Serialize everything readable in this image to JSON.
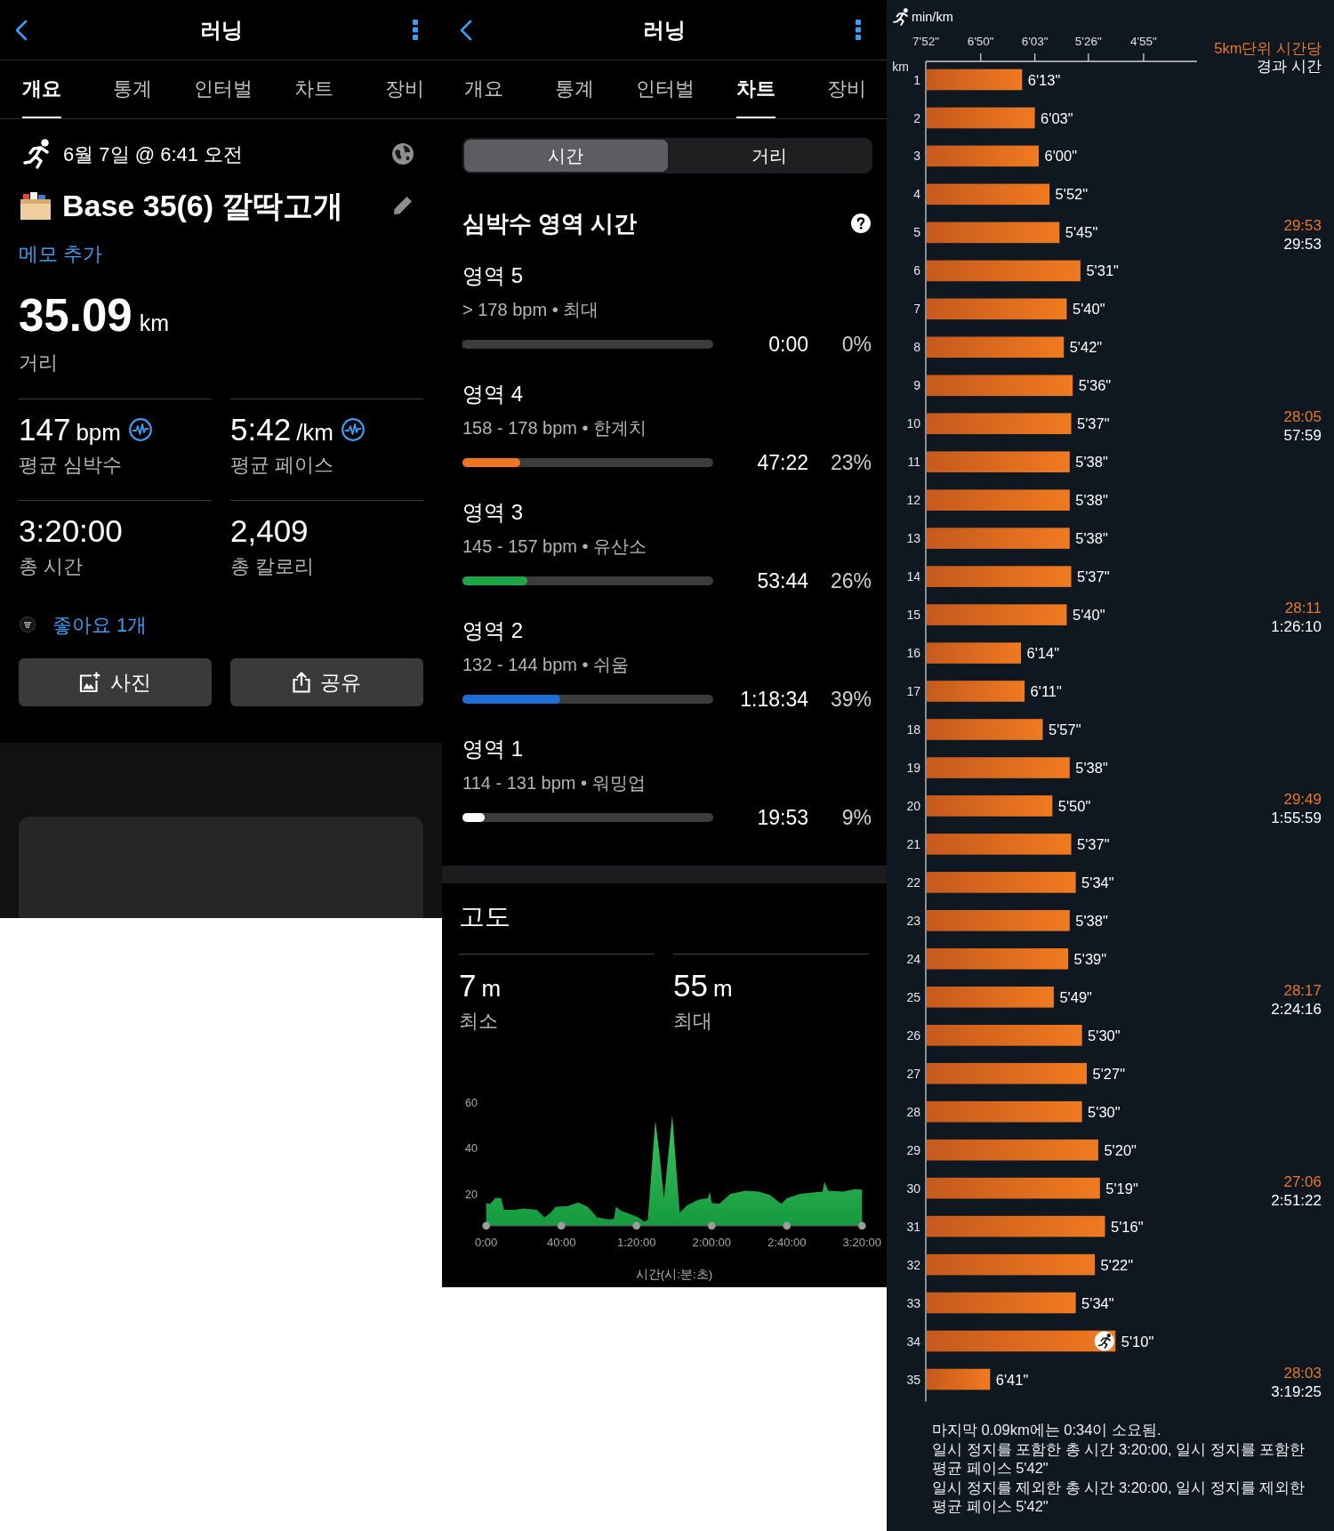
{
  "overview_screen": {
    "header": {
      "title": "러닝"
    },
    "tabs": [
      {
        "label": "개요",
        "selected": true
      },
      {
        "label": "통계",
        "selected": false
      },
      {
        "label": "인터벌",
        "selected": false
      },
      {
        "label": "차트",
        "selected": false
      },
      {
        "label": "장비",
        "selected": false
      }
    ],
    "activity": {
      "date": "6월 7일 @ 6:41 오전",
      "name": "Base 35(6) 깔딱고개",
      "note_link": "메모 추가"
    },
    "distance": {
      "value": "35.09",
      "unit": "km",
      "label": "거리"
    },
    "stats": [
      {
        "value": "147",
        "unit": "bpm",
        "label": "평균 심박수",
        "kind": "pulse"
      },
      {
        "value": "5:42",
        "unit": "/km",
        "label": "평균 페이스",
        "kind": "pulse"
      },
      {
        "value": "3:20:00",
        "label": "총 시간",
        "kind": "plain"
      },
      {
        "value": "2,409",
        "label": "총 칼로리",
        "kind": "plain"
      }
    ],
    "likes": {
      "label": "좋아요 1개"
    },
    "buttons": [
      {
        "label": "사진",
        "kind": "photo"
      },
      {
        "label": "공유",
        "kind": "share"
      }
    ]
  },
  "chart_screen": {
    "header": {
      "title": "러닝"
    },
    "tabs": [
      {
        "label": "개요",
        "selected": false
      },
      {
        "label": "통계",
        "selected": false
      },
      {
        "label": "인터벌",
        "selected": false
      },
      {
        "label": "차트",
        "selected": true
      },
      {
        "label": "장비",
        "selected": false
      }
    ],
    "segments": [
      {
        "label": "시간",
        "selected": true
      },
      {
        "label": "거리",
        "selected": false
      }
    ],
    "heart_rate_zones": {
      "title": "심박수 영역 시간",
      "zones": [
        {
          "name": "영역 5",
          "range": "> 178 bpm • 최대",
          "time": "0:00",
          "percent": "0%",
          "level": 0
        },
        {
          "name": "영역 4",
          "range": "158 - 178 bpm • 한계치",
          "time": "47:22",
          "percent": "23%",
          "level": 0.23,
          "color": "#ee7623"
        },
        {
          "name": "영역 3",
          "range": "145 - 157 bpm • 유산소",
          "time": "53:44",
          "percent": "26%",
          "level": 0.26,
          "color": "#1fa447"
        },
        {
          "name": "영역 2",
          "range": "132 - 144 bpm • 쉬움",
          "time": "1:18:34",
          "percent": "39%",
          "level": 0.39,
          "color": "#1d6fd8"
        },
        {
          "name": "영역 1",
          "range": "114 - 131 bpm • 워밍업",
          "time": "19:53",
          "percent": "9%",
          "level": 0.09,
          "color": "#ffffff"
        }
      ]
    },
    "elevation": {
      "title": "고도",
      "stats": [
        {
          "value": "7",
          "unit": "m",
          "label": "최소"
        },
        {
          "value": "55",
          "unit": "m",
          "label": "최대"
        }
      ],
      "chart_data": {
        "type": "area",
        "xlabel": "시간(시:분:초)",
        "x": [
          0,
          2,
          5,
          8,
          9.5,
          15,
          20,
          27,
          31,
          34,
          37,
          43,
          49,
          54,
          59,
          65,
          68,
          69,
          72,
          77,
          81,
          84,
          86,
          90,
          92,
          94.6,
          97,
          99,
          101,
          103,
          107,
          113,
          118,
          119,
          120,
          124,
          130,
          138,
          145,
          151,
          157,
          160,
          167,
          176,
          179,
          180,
          182,
          190,
          196,
          200
        ],
        "values": [
          16,
          15.5,
          18.2,
          18,
          13,
          13,
          13.6,
          13,
          9.7,
          11.5,
          14.3,
          14.5,
          16.2,
          14.3,
          9.7,
          8.8,
          9,
          14.3,
          12.5,
          11,
          9.7,
          7.8,
          8.5,
          52,
          39,
          18,
          38,
          54.5,
          33,
          11.7,
          15,
          17.5,
          18,
          21,
          16,
          15.6,
          20,
          21.4,
          21,
          19.5,
          15.6,
          18,
          20,
          20.8,
          21,
          25.3,
          21.4,
          21,
          22,
          21.8
        ],
        "xlim": [
          0,
          200
        ],
        "ylim": [
          6,
          60
        ],
        "xticks": [
          {
            "value": 0,
            "label": "0:00"
          },
          {
            "value": 40,
            "label": "40:00"
          },
          {
            "value": 80,
            "label": "1:20:00"
          },
          {
            "value": 120,
            "label": "2:00:00"
          },
          {
            "value": 160,
            "label": "2:40:00"
          },
          {
            "value": 200,
            "label": "3:20:00"
          }
        ],
        "yticks": [
          20,
          40,
          60
        ]
      }
    }
  },
  "pace_screen": {
    "unit_label": "min/km",
    "axis_labels": [
      "7'52\"",
      "6'50\"",
      "6'03\"",
      "5'26\"",
      "4'55\""
    ],
    "km_title": "km",
    "rows": [
      {
        "km": "1",
        "pace": "6'13\""
      },
      {
        "km": "2",
        "pace": "6'03\""
      },
      {
        "km": "3",
        "pace": "6'00\""
      },
      {
        "km": "4",
        "pace": "5'52\""
      },
      {
        "km": "5",
        "pace": "5'45\""
      },
      {
        "km": "6",
        "pace": "5'31\""
      },
      {
        "km": "7",
        "pace": "5'40\""
      },
      {
        "km": "8",
        "pace": "5'42\""
      },
      {
        "km": "9",
        "pace": "5'36\""
      },
      {
        "km": "10",
        "pace": "5'37\""
      },
      {
        "km": "11",
        "pace": "5'38\""
      },
      {
        "km": "12",
        "pace": "5'38\""
      },
      {
        "km": "13",
        "pace": "5'38\""
      },
      {
        "km": "14",
        "pace": "5'37\""
      },
      {
        "km": "15",
        "pace": "5'40\""
      },
      {
        "km": "16",
        "pace": "6'14\""
      },
      {
        "km": "17",
        "pace": "6'11\""
      },
      {
        "km": "18",
        "pace": "5'57\""
      },
      {
        "km": "19",
        "pace": "5'38\""
      },
      {
        "km": "20",
        "pace": "5'50\""
      },
      {
        "km": "21",
        "pace": "5'37\""
      },
      {
        "km": "22",
        "pace": "5'34\""
      },
      {
        "km": "23",
        "pace": "5'38\""
      },
      {
        "km": "24",
        "pace": "5'39\""
      },
      {
        "km": "25",
        "pace": "5'49\""
      },
      {
        "km": "26",
        "pace": "5'30\""
      },
      {
        "km": "27",
        "pace": "5'27\""
      },
      {
        "km": "28",
        "pace": "5'30\""
      },
      {
        "km": "29",
        "pace": "5'20\""
      },
      {
        "km": "30",
        "pace": "5'19\""
      },
      {
        "km": "31",
        "pace": "5'16\""
      },
      {
        "km": "32",
        "pace": "5'22\""
      },
      {
        "km": "33",
        "pace": "5'34\""
      },
      {
        "km": "34",
        "pace": "5'10\""
      },
      {
        "km": "35",
        "pace": "6'41\""
      }
    ],
    "splits_header": {
      "split": "5km단위 시간당",
      "elapsed": "경과 시간"
    },
    "splits": [
      {
        "split": "29:53",
        "elapsed": "29:53"
      },
      {
        "split": "28:05",
        "elapsed": "57:59"
      },
      {
        "split": "28:11",
        "elapsed": "1:26:10"
      },
      {
        "split": "29:49",
        "elapsed": "1:55:59"
      },
      {
        "split": "28:17",
        "elapsed": "2:24:16"
      },
      {
        "split": "27:06",
        "elapsed": "2:51:22"
      },
      {
        "split": "28:03",
        "elapsed": "3:19:25"
      }
    ],
    "notes": [
      "마지막 0.09km에는 0:34이 소요됨.",
      "일시 정지를 포함한 총 시간 3:20:00, 일시 정지를 포함한 평균 페이스 5'42\"",
      "일시 정지를 제외한 총 시간 3:20:00, 일시 정지를 제외한 평균 페이스 5'42\""
    ]
  }
}
